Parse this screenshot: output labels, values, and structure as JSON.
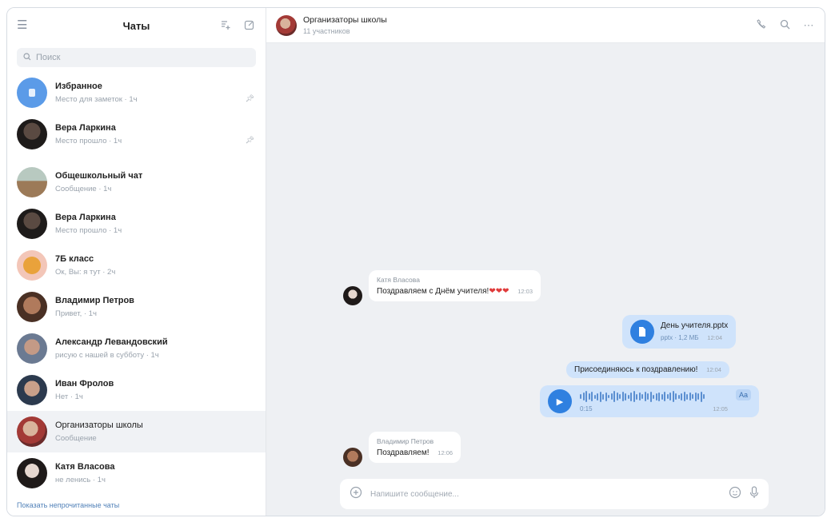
{
  "sidebar": {
    "title": "Чаты",
    "search_placeholder": "Поиск",
    "footer_link": "Показать непрочитанные чаты",
    "items": [
      {
        "name": "Избранное",
        "preview": "Место для заметок · 1ч"
      },
      {
        "name": "Вера Ларкина",
        "preview": "Место прошло · 1ч"
      },
      {
        "name": "Общешкольный чат",
        "preview": "Сообщение · 1ч"
      },
      {
        "name": "Вера Ларкина",
        "preview": "Место прошло · 1ч"
      },
      {
        "name": "7Б класс",
        "preview": "Ок, Вы: я тут · 2ч"
      },
      {
        "name": "Владимир Петров",
        "preview": "Привет, · 1ч"
      },
      {
        "name": "Александр Левандовский",
        "preview": "рисую с нашей в субботу · 1ч"
      },
      {
        "name": "Иван Фролов",
        "preview": "Нет · 1ч"
      },
      {
        "name": "Организаторы школы",
        "preview": "Сообщение"
      },
      {
        "name": "Катя Власова",
        "preview": "не ленись · 1ч"
      }
    ]
  },
  "chat": {
    "title": "Организаторы школы",
    "subtitle": "11 участников",
    "composer_placeholder": "Напишите сообщение...",
    "messages": {
      "m1_author": "Катя Власова",
      "m1_text": "Поздравляем с Днём учителя!",
      "m1_emoji": "❤❤❤",
      "m1_time": "12:03",
      "file_name": "День учителя.pptx",
      "file_meta": "pptx · 1,2 МБ",
      "file_time": "12:04",
      "m3_text": "Присоединяюсь к поздравлению!",
      "m3_time": "12:04",
      "voice_duration": "0:15",
      "voice_badge": "Aa",
      "voice_time": "12:05",
      "m5_author": "Владимир Петров",
      "m5_text": "Поздравляем!",
      "m5_time": "12:06"
    }
  },
  "colors": {
    "accent": "#2f80e0",
    "outgoing_bubble": "#cfe3fb",
    "chat_background": "#eef0f3"
  }
}
